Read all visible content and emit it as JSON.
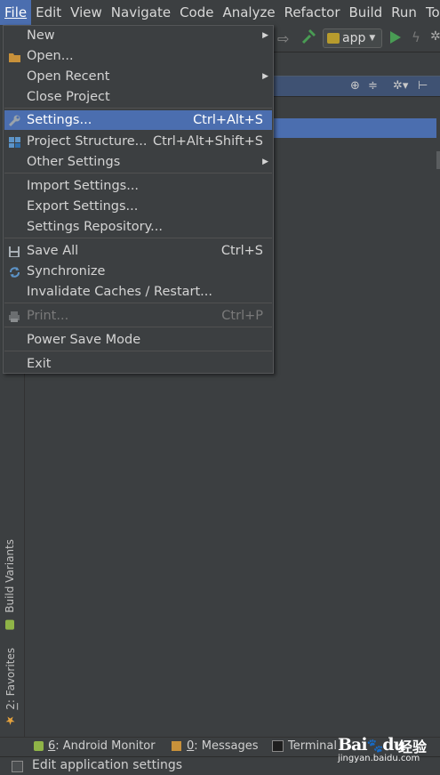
{
  "menubar": {
    "items": [
      {
        "label": "File",
        "active": true
      },
      {
        "label": "Edit"
      },
      {
        "label": "View"
      },
      {
        "label": "Navigate"
      },
      {
        "label": "Code"
      },
      {
        "label": "Analyze"
      },
      {
        "label": "Refactor"
      },
      {
        "label": "Build"
      },
      {
        "label": "Run"
      },
      {
        "label": "Tools"
      }
    ]
  },
  "toolbar": {
    "run_config": "app",
    "icons": [
      "back-forward-icon",
      "hammer-icon",
      "android-icon",
      "play-icon",
      "lightning-icon"
    ]
  },
  "file_menu": {
    "items": [
      {
        "label": "New",
        "submenu": true
      },
      {
        "label": "Open...",
        "icon": "folder-icon"
      },
      {
        "label": "Open Recent",
        "submenu": true
      },
      {
        "label": "Close Project"
      },
      {
        "label": "Settings...",
        "shortcut": "Ctrl+Alt+S",
        "icon": "wrench-icon",
        "selected": true
      },
      {
        "label": "Project Structure...",
        "shortcut": "Ctrl+Alt+Shift+S",
        "icon": "project-structure-icon"
      },
      {
        "label": "Other Settings",
        "submenu": true
      },
      {
        "label": "Import Settings..."
      },
      {
        "label": "Export Settings..."
      },
      {
        "label": "Settings Repository..."
      },
      {
        "label": "Save All",
        "shortcut": "Ctrl+S",
        "icon": "save-icon"
      },
      {
        "label": "Synchronize",
        "icon": "sync-icon"
      },
      {
        "label": "Invalidate Caches / Restart..."
      },
      {
        "label": "Print...",
        "shortcut": "Ctrl+P",
        "icon": "print-icon",
        "disabled": true
      },
      {
        "label": "Power Save Mode"
      },
      {
        "label": "Exit"
      }
    ]
  },
  "left_toolwindows": {
    "build_variants": "Build Variants",
    "favorites_num": "2",
    "favorites_label": ": Favorites"
  },
  "bottom_tabs": {
    "android_monitor_num": "6",
    "android_monitor_label": ": Android Monitor",
    "messages_num": "0",
    "messages_label": ": Messages",
    "terminal_label": "Terminal"
  },
  "status": {
    "text": "Edit application settings"
  },
  "watermark": {
    "brand": "Bai",
    "brand2": "du",
    "cn": "经验",
    "url": "jingyan.baidu.com"
  },
  "colors": {
    "background": "#3c3f41",
    "selection": "#4b6eaf",
    "run_green": "#499c54"
  }
}
